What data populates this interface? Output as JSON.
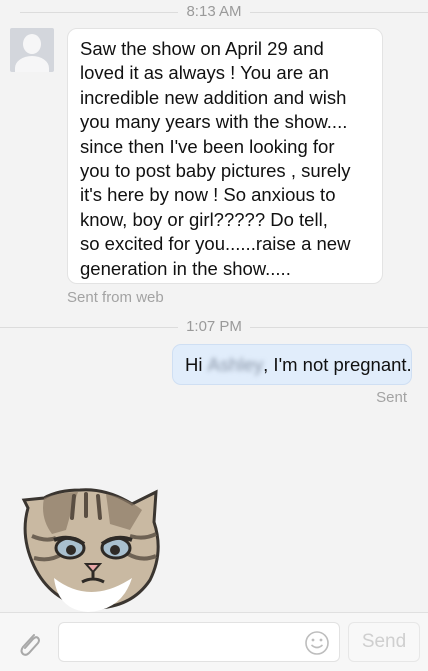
{
  "conversation": {
    "timestamp_1": "8:13 AM",
    "incoming": {
      "lines": [
        "Saw the show on April 29 and",
        "loved it as always !  You are an",
        "incredible new addition and wish",
        "you many years with the show....",
        "since then I've been looking for",
        "you to post baby pictures , surely",
        "it's here by now !  So anxious to",
        "know, boy or girl????? Do tell,",
        "so excited for you......raise a new",
        "generation in the show....."
      ],
      "meta": "Sent from web"
    },
    "timestamp_2": "1:07 PM",
    "outgoing": {
      "greeting": "Hi",
      "redacted_name": "Ashley",
      "text_after": ", I'm not pregnant.",
      "status": "Sent"
    }
  },
  "composer": {
    "placeholder": "",
    "send_label": "Send",
    "attach_icon": "paperclip-icon",
    "emoji_icon": "smiley-icon"
  },
  "colors": {
    "background": "#f3f3f3",
    "outgoing_bubble": "#e1edfb",
    "incoming_bubble": "#ffffff",
    "meta_text": "#a3a3a3"
  }
}
